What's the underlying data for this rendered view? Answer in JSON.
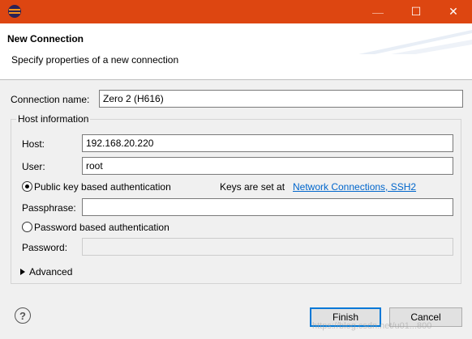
{
  "window": {
    "minimize_glyph": "—",
    "maximize_glyph": "☐",
    "close_glyph": "✕"
  },
  "header": {
    "title": "New Connection",
    "description": "Specify properties of a new connection"
  },
  "form": {
    "connection_name_label": "Connection name:",
    "connection_name_value": "Zero 2 (H616)",
    "host_group_label": "Host information",
    "host_label": "Host:",
    "host_value": "192.168.20.220",
    "user_label": "User:",
    "user_value": "root",
    "pubkey_radio_label": "Public key based authentication",
    "pubkey_checked": true,
    "keys_note_prefix": "Keys are set at",
    "keys_link": "Network Connections, SSH2",
    "passphrase_label": "Passphrase:",
    "passphrase_value": "",
    "password_radio_label": "Password based authentication",
    "password_checked": false,
    "password_label": "Password:",
    "password_value": "",
    "advanced_label": "Advanced"
  },
  "footer": {
    "help_glyph": "?",
    "finish_label": "Finish",
    "cancel_label": "Cancel",
    "watermark": "https://blog.csdn.net/u01...800"
  },
  "colors": {
    "titlebar": "#dd4611",
    "link": "#0066cc",
    "default_button_border": "#0078d7"
  },
  "icons": {
    "app": "eclipse-icon",
    "help": "help-icon",
    "expand": "triangle-right-icon"
  }
}
